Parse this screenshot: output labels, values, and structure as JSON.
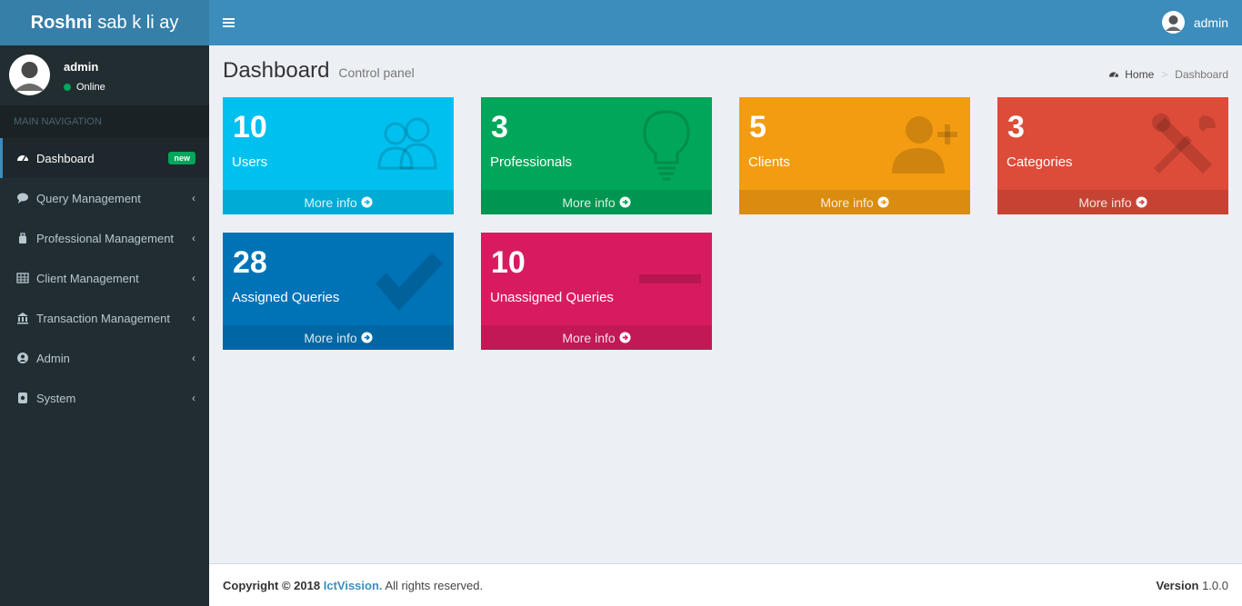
{
  "header": {
    "logo_bold": "Roshni",
    "logo_rest": "sab k li ay",
    "user_name": "admin"
  },
  "sidebar": {
    "user_name": "admin",
    "user_status": "Online",
    "nav_header": "MAIN NAVIGATION",
    "items": [
      {
        "label": "Dashboard",
        "badge": "new",
        "icon": "dashboard-icon"
      },
      {
        "label": "Query Management",
        "icon": "comment-icon"
      },
      {
        "label": "Professional Management",
        "icon": "briefcase-icon"
      },
      {
        "label": "Client Management",
        "icon": "table-icon"
      },
      {
        "label": "Transaction Management",
        "icon": "bank-icon"
      },
      {
        "label": "Admin",
        "icon": "user-circle-icon"
      },
      {
        "label": "System",
        "icon": "gear-icon"
      }
    ]
  },
  "content": {
    "title": "Dashboard",
    "subtitle": "Control panel",
    "breadcrumb_home": "Home",
    "breadcrumb_current": "Dashboard"
  },
  "boxes": [
    {
      "count": "10",
      "label": "Users",
      "more": "More info",
      "color": "#00c0ef",
      "icon": "users-icon"
    },
    {
      "count": "3",
      "label": "Professionals",
      "more": "More info",
      "color": "#00a65a",
      "icon": "lightbulb-icon"
    },
    {
      "count": "5",
      "label": "Clients",
      "more": "More info",
      "color": "#f39c12",
      "icon": "user-plus-icon"
    },
    {
      "count": "3",
      "label": "Categories",
      "more": "More info",
      "color": "#dd4b39",
      "icon": "tools-icon"
    },
    {
      "count": "28",
      "label": "Assigned Queries",
      "more": "More info",
      "color": "#0073b7",
      "icon": "check-icon"
    },
    {
      "count": "10",
      "label": "Unassigned Queries",
      "more": "More info",
      "color": "#d81b60",
      "icon": "minus-icon"
    }
  ],
  "footer": {
    "copyright_prefix": "Copyright © 2018",
    "brand": "IctVission.",
    "rights": "All rights reserved.",
    "version_label": "Version",
    "version_value": "1.0.0"
  }
}
